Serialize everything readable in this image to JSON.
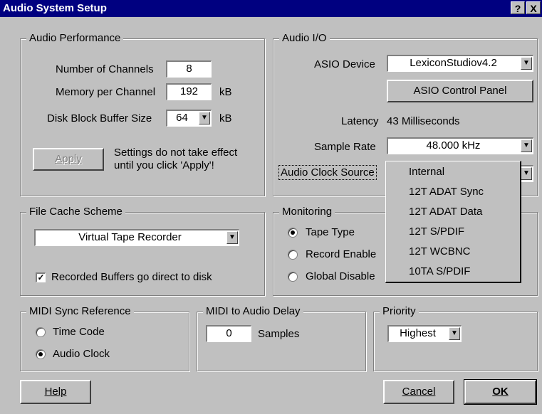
{
  "window": {
    "title": "Audio System Setup",
    "help_glyph": "?",
    "close_glyph": "X"
  },
  "performance": {
    "legend": "Audio Performance",
    "channels_label": "Number of Channels",
    "channels_value": "8",
    "memory_label": "Memory per Channel",
    "memory_value": "192",
    "memory_unit": "kB",
    "buffer_label": "Disk Block Buffer Size",
    "buffer_value": "64",
    "buffer_unit": "kB",
    "apply_label": "Apply",
    "apply_note_1": "Settings do not take effect",
    "apply_note_2": "until you click 'Apply'!"
  },
  "io": {
    "legend": "Audio I/O",
    "device_label": "ASIO Device",
    "device_value": "LexiconStudiov4.2",
    "control_panel_label": "ASIO Control Panel",
    "latency_label": "Latency",
    "latency_value": "43 Milliseconds",
    "sample_rate_label": "Sample Rate",
    "sample_rate_value": "48.000 kHz",
    "clock_source_label": "Audio Clock Source",
    "clock_options": [
      "Internal",
      "12T ADAT Sync",
      "12T ADAT Data",
      "12T S/PDIF",
      "12T WCBNC",
      "10TA S/PDIF"
    ]
  },
  "cache": {
    "legend": "File Cache Scheme",
    "scheme_value": "Virtual Tape Recorder",
    "direct_label": "Recorded Buffers go direct to disk"
  },
  "monitoring": {
    "legend": "Monitoring",
    "options": [
      "Tape Type",
      "Record Enable",
      "Global Disable"
    ]
  },
  "midi_sync": {
    "legend": "MIDI Sync Reference",
    "options": [
      "Time Code",
      "Audio Clock"
    ]
  },
  "midi_delay": {
    "legend": "MIDI to Audio Delay",
    "value": "0",
    "unit": "Samples"
  },
  "priority": {
    "legend": "Priority",
    "value": "Highest"
  },
  "buttons": {
    "help": "Help",
    "cancel": "Cancel",
    "ok": "OK"
  },
  "icons": {
    "dropdown_arrow": "▼"
  }
}
